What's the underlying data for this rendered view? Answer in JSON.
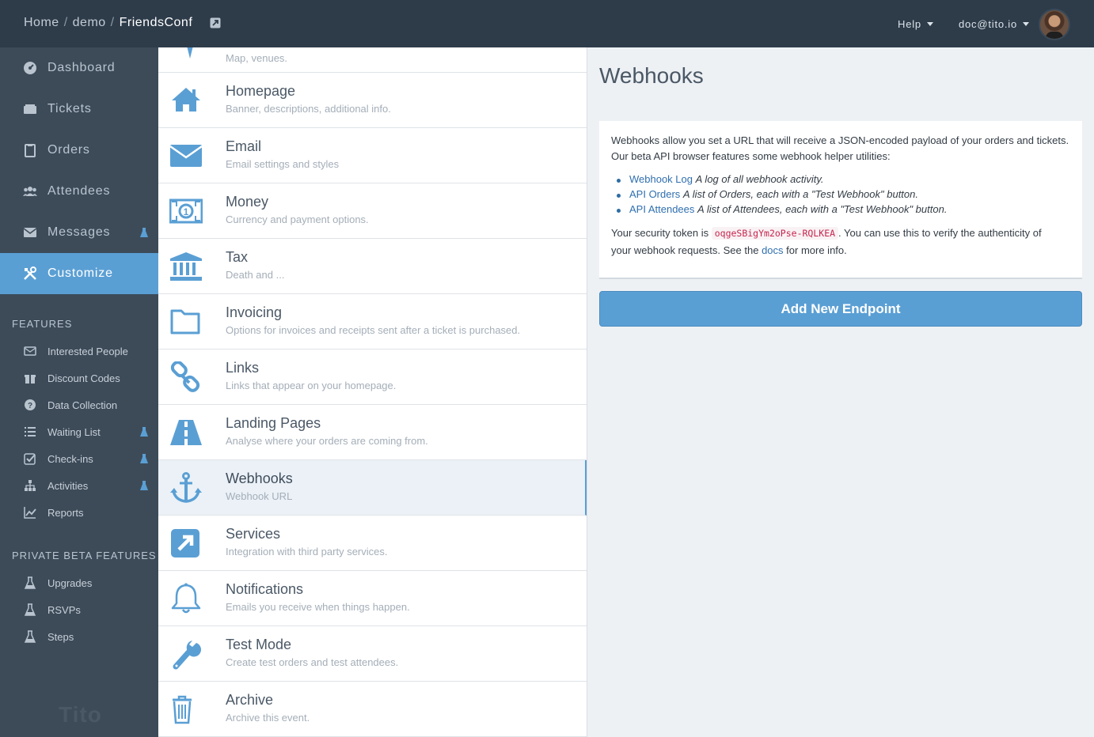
{
  "breadcrumb": {
    "home": "Home",
    "org": "demo",
    "event": "FriendsConf",
    "sep": "/"
  },
  "topnav": {
    "help": "Help",
    "user": "doc@tito.io"
  },
  "sidebar": {
    "main": [
      {
        "label": "Dashboard",
        "icon": "dashboard-icon"
      },
      {
        "label": "Tickets",
        "icon": "tickets-icon"
      },
      {
        "label": "Orders",
        "icon": "clipboard-icon"
      },
      {
        "label": "Attendees",
        "icon": "users-icon"
      },
      {
        "label": "Messages",
        "icon": "envelope-icon",
        "beta": true
      },
      {
        "label": "Customize",
        "icon": "tools-icon",
        "active": true
      }
    ],
    "features_heading": "FEATURES",
    "features": [
      {
        "label": "Interested People",
        "icon": "envelope-outline-icon"
      },
      {
        "label": "Discount Codes",
        "icon": "gift-icon"
      },
      {
        "label": "Data Collection",
        "icon": "question-circle-icon"
      },
      {
        "label": "Waiting List",
        "icon": "list-icon",
        "beta": true
      },
      {
        "label": "Check-ins",
        "icon": "check-square-icon",
        "beta": true
      },
      {
        "label": "Activities",
        "icon": "sitemap-icon",
        "beta": true
      },
      {
        "label": "Reports",
        "icon": "line-chart-icon"
      }
    ],
    "private_heading": "PRIVATE BETA FEATURES",
    "private": [
      {
        "label": "Upgrades",
        "icon": "flask-icon"
      },
      {
        "label": "RSVPs",
        "icon": "flask-icon"
      },
      {
        "label": "Steps",
        "icon": "flask-icon"
      }
    ],
    "brand": "Tito"
  },
  "settings_list": [
    {
      "title": "",
      "sub": "Map, venues.",
      "icon": "map-pin-icon"
    },
    {
      "title": "Homepage",
      "sub": "Banner, descriptions, additional info.",
      "icon": "home-icon"
    },
    {
      "title": "Email",
      "sub": "Email settings and styles",
      "icon": "envelope-icon"
    },
    {
      "title": "Money",
      "sub": "Currency and payment options.",
      "icon": "money-icon"
    },
    {
      "title": "Tax",
      "sub": "Death and ...",
      "icon": "bank-icon"
    },
    {
      "title": "Invoicing",
      "sub": "Options for invoices and receipts sent after a ticket is purchased.",
      "icon": "folder-icon"
    },
    {
      "title": "Links",
      "sub": "Links that appear on your homepage.",
      "icon": "link-icon"
    },
    {
      "title": "Landing Pages",
      "sub": "Analyse where your orders are coming from.",
      "icon": "road-icon"
    },
    {
      "title": "Webhooks",
      "sub": "Webhook URL",
      "icon": "anchor-icon",
      "selected": true
    },
    {
      "title": "Services",
      "sub": "Integration with third party services.",
      "icon": "external-link-icon"
    },
    {
      "title": "Notifications",
      "sub": "Emails you receive when things happen.",
      "icon": "bell-icon"
    },
    {
      "title": "Test Mode",
      "sub": "Create test orders and test attendees.",
      "icon": "wrench-icon"
    },
    {
      "title": "Archive",
      "sub": "Archive this event.",
      "icon": "trash-icon"
    }
  ],
  "webhooks": {
    "title": "Webhooks",
    "intro_line1": "Webhooks allow you set a URL that will receive a JSON-encoded payload of your orders and tickets.",
    "intro_line2": "Our beta API browser features some webhook helper utilities:",
    "links": [
      {
        "link": "Webhook Log",
        "desc": "A log of all webhook activity."
      },
      {
        "link": "API Orders",
        "desc": "A list of Orders, each with a \"Test Webhook\" button."
      },
      {
        "link": "API Attendees",
        "desc": "A list of Attendees, each with a \"Test Webhook\" button."
      }
    ],
    "token_prefix": "Your security token is",
    "token": "oqgeSBigYm2oPse-RQLKEA",
    "token_suffix": ". You can use this to verify the authenticity of",
    "line2_prefix": "your webhook requests. See the",
    "docs_link": "docs",
    "line2_suffix": "for more info.",
    "add_button": "Add New Endpoint"
  },
  "colors": {
    "accent": "#5a9fd4",
    "sidebar": "#3d4b59",
    "topbar": "#2e3c4a",
    "token": "#c7254e"
  }
}
